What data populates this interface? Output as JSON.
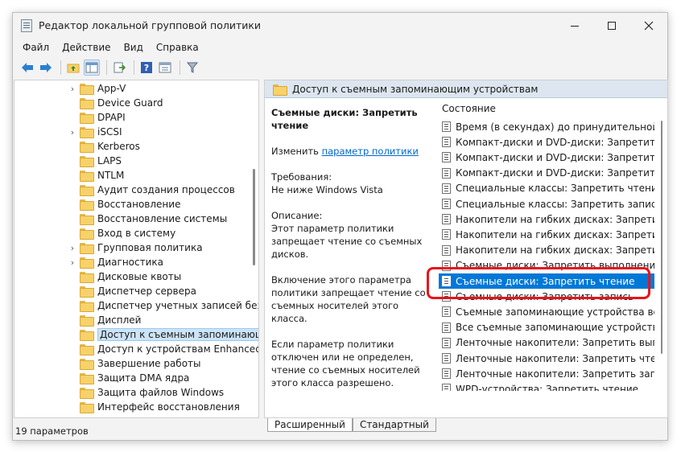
{
  "window": {
    "title": "Редактор локальной групповой политики"
  },
  "menu": [
    "Файл",
    "Действие",
    "Вид",
    "Справка"
  ],
  "toolbar": {
    "buttons": [
      "back-icon",
      "forward-icon",
      "folder-up-icon",
      "show-hide-tree-icon",
      "export-list-icon",
      "help-icon",
      "properties-icon",
      "filter-icon"
    ]
  },
  "tree": {
    "items": [
      {
        "label": "App-V",
        "expandable": true
      },
      {
        "label": "Device Guard",
        "expandable": false
      },
      {
        "label": "DPAPI",
        "expandable": false
      },
      {
        "label": "iSCSI",
        "expandable": true
      },
      {
        "label": "Kerberos",
        "expandable": false
      },
      {
        "label": "LAPS",
        "expandable": false
      },
      {
        "label": "NTLM",
        "expandable": false
      },
      {
        "label": "Аудит создания процессов",
        "expandable": false
      },
      {
        "label": "Восстановление",
        "expandable": false
      },
      {
        "label": "Восстановление системы",
        "expandable": false
      },
      {
        "label": "Вход в систему",
        "expandable": false
      },
      {
        "label": "Групповая политика",
        "expandable": true
      },
      {
        "label": "Диагностика",
        "expandable": true
      },
      {
        "label": "Дисковые квоты",
        "expandable": false
      },
      {
        "label": "Диспетчер сервера",
        "expandable": false
      },
      {
        "label": "Диспетчер учетных записей безопасности",
        "expandable": false
      },
      {
        "label": "Дисплей",
        "expandable": false
      },
      {
        "label": "Доступ к съемным запоминающим устройствам",
        "expandable": false,
        "selected": true
      },
      {
        "label": "Доступ к устройствам Enhanced Storage",
        "expandable": false
      },
      {
        "label": "Завершение работы",
        "expandable": false
      },
      {
        "label": "Защита DMA ядра",
        "expandable": false
      },
      {
        "label": "Защита файлов Windows",
        "expandable": false
      },
      {
        "label": "Интерфейс восстановления",
        "expandable": false
      }
    ]
  },
  "right_pane": {
    "header": "Доступ к съемным запоминающим устройствам",
    "description": {
      "title": "Съемные диски: Запретить чтение",
      "edit_prefix": "Изменить ",
      "edit_link": "параметр политики",
      "requirements_label": "Требования:",
      "requirements_value": "Не ниже Windows Vista",
      "description_label": "Описание:",
      "description_text": "Этот параметр политики запрещает чтение со съемных дисков.",
      "enabled_text": "Включение этого параметра политики запрещает чтение со съемных носителей этого класса.",
      "disabled_text": "Если параметр политики отключен или не определен, чтение со съемных носителей этого класса разрешено."
    },
    "list_header": "Состояние",
    "policies": [
      "Время (в секундах) до принудительной перезагрузки",
      "Компакт-диски и DVD-диски: Запретить выполнение",
      "Компакт-диски и DVD-диски: Запретить чтение",
      "Компакт-диски и DVD-диски: Запретить запись",
      "Специальные классы: Запретить чтение",
      "Специальные классы: Запретить запись",
      "Накопители на гибких дисках: Запретить выполнение",
      "Накопители на гибких дисках: Запретить чтение",
      "Накопители на гибких дисках: Запретить запись",
      "Съемные диски: Запретить выполнение",
      "Съемные диски: Запретить чтение",
      "Съемные диски: Запретить запись",
      "Съемные запоминающие устройства всех классов",
      "Все съемные запоминающие устройства: разрешение",
      "Ленточные накопители: Запретить выполнение",
      "Ленточные накопители: Запретить чтение",
      "Ленточные накопители: Запретить запись",
      "WPD-устройства: Запретить чтение"
    ],
    "selected_policy_index": 10
  },
  "tabs": [
    "Расширенный",
    "Стандартный"
  ],
  "status": "19 параметров",
  "colors": {
    "selection": "#0078d7",
    "highlight": "#e8141b"
  }
}
